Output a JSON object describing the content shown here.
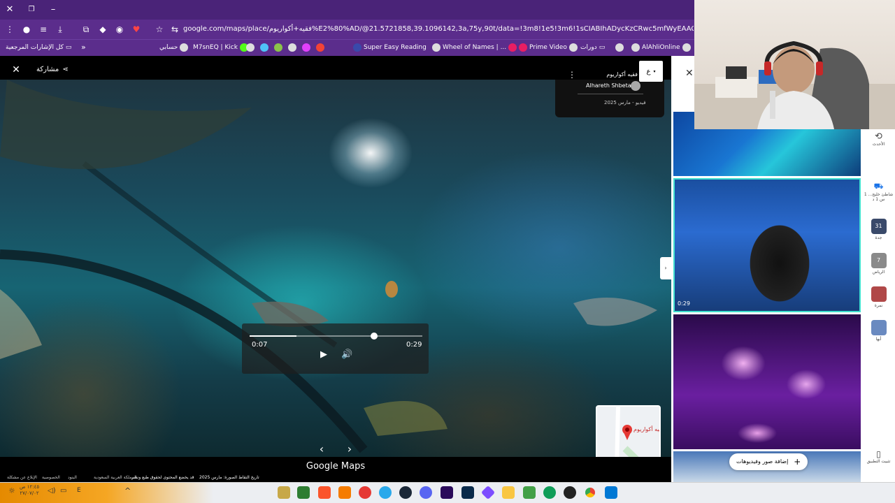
{
  "browser": {
    "url": "google.com/maps/place/@21.5721858,39.1096142,3a,75y,90t/data=!3m8!1e5!3m6!1sCIABIhADycKzCRwc5mfWyEAAC1kOi2e10!3e10!6shttps%3A%2F%2F…",
    "url_display": "google.com/maps/place/فقيه+أكواريوم%E2%80%AD/@21.5721858,39.1096142,3a,75y,90t/data=!3m8!1e5!3m6!1sCIABIhADycKzCRwc5mfWyEAAC1kOi2e10!3e10!6shttps%3A%2F%2",
    "bookmarks": [
      {
        "label": "AlAhliOnline"
      },
      {
        "label": ""
      },
      {
        "label": "دورات"
      },
      {
        "label": "Prime Video"
      },
      {
        "label": "م... "
      },
      {
        "label": "Wheel of Names | ..."
      },
      {
        "label": "Super Easy Reading"
      },
      {
        "label": ""
      },
      {
        "label": "M7snEQ | Kick"
      },
      {
        "label": "حسابي"
      }
    ],
    "all_bookmarks_label": "كل الإشارات المرجعية",
    "more_label": "»"
  },
  "maps": {
    "share_label": "مشاركة",
    "place_name": "فقيه أكواريوم",
    "contributor": "Alhareth Shbeta",
    "media_date": "فيديو - مارس 2025",
    "lang_badge": "ع",
    "current_time": "0:07",
    "duration": "0:29",
    "progress": 0.72,
    "buffered": 0.27,
    "brand": "Google Maps",
    "capture_date": "تاريخ التقاط الصورة: مارس 2025",
    "disclaimer": "قد يخضع المحتوى لحقوق طبع ونشر",
    "footer_links": [
      "المملكة العربية السعودية",
      "البنود",
      "الخصوصية",
      "الإبلاغ عن مشكلة"
    ],
    "map_label": "فقيه أكواريوم"
  },
  "sidebar": {
    "duration_badge": "0:29",
    "add_media_label": "إضافة صور وفيديوهات",
    "rail": [
      {
        "label": "الأحدث"
      },
      {
        "label": "شاطئ خليج... 1 س 1 د"
      },
      {
        "label": "جدة"
      },
      {
        "label": "الرياض"
      },
      {
        "label": "نمرة"
      },
      {
        "label": "أبها"
      },
      {
        "label": "تثبيت التطبيق"
      }
    ],
    "rail_badges": [
      "31",
      "7"
    ]
  },
  "taskbar": {
    "time": "١٢:٤٥ ص",
    "date": "٢٧/٠٧/٠٢"
  }
}
